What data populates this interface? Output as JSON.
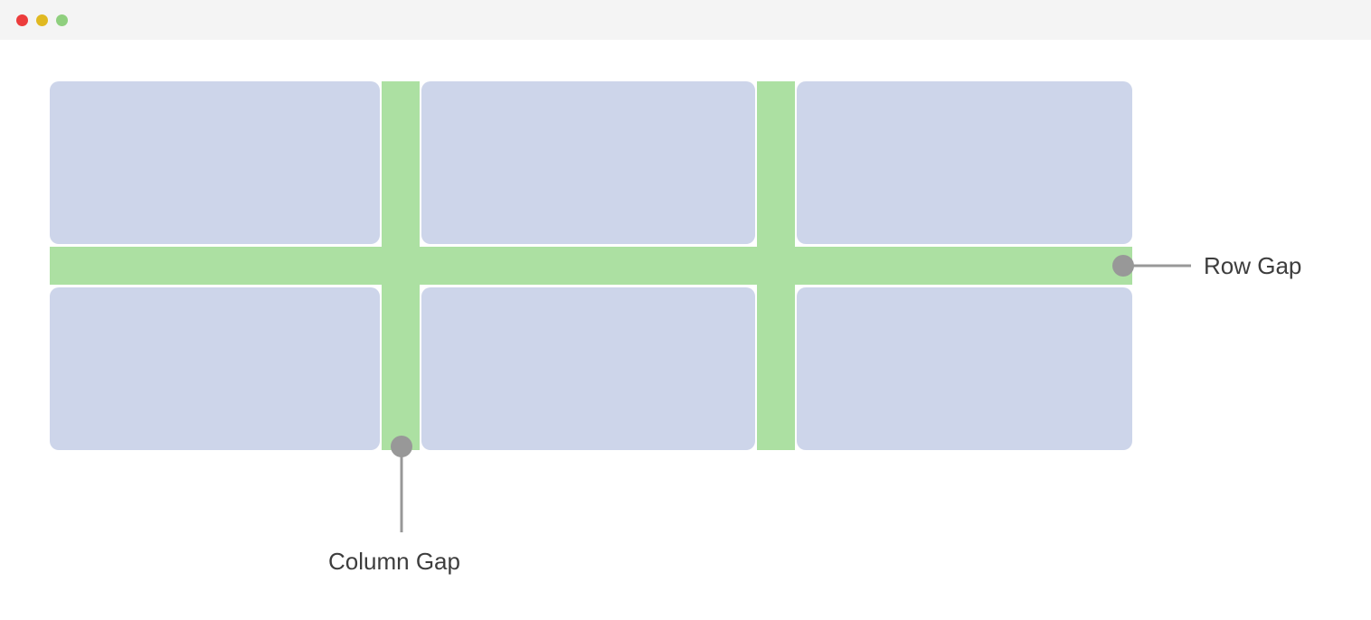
{
  "titlebar": {
    "traffic_lights": [
      "close",
      "minimize",
      "zoom"
    ]
  },
  "diagram": {
    "grid": {
      "rows": 2,
      "cols": 3,
      "cell_fill": "#cdd5ea",
      "gap_fill": "#ace0a2"
    },
    "annotations": {
      "row_gap_label": "Row Gap",
      "column_gap_label": "Column Gap"
    }
  }
}
